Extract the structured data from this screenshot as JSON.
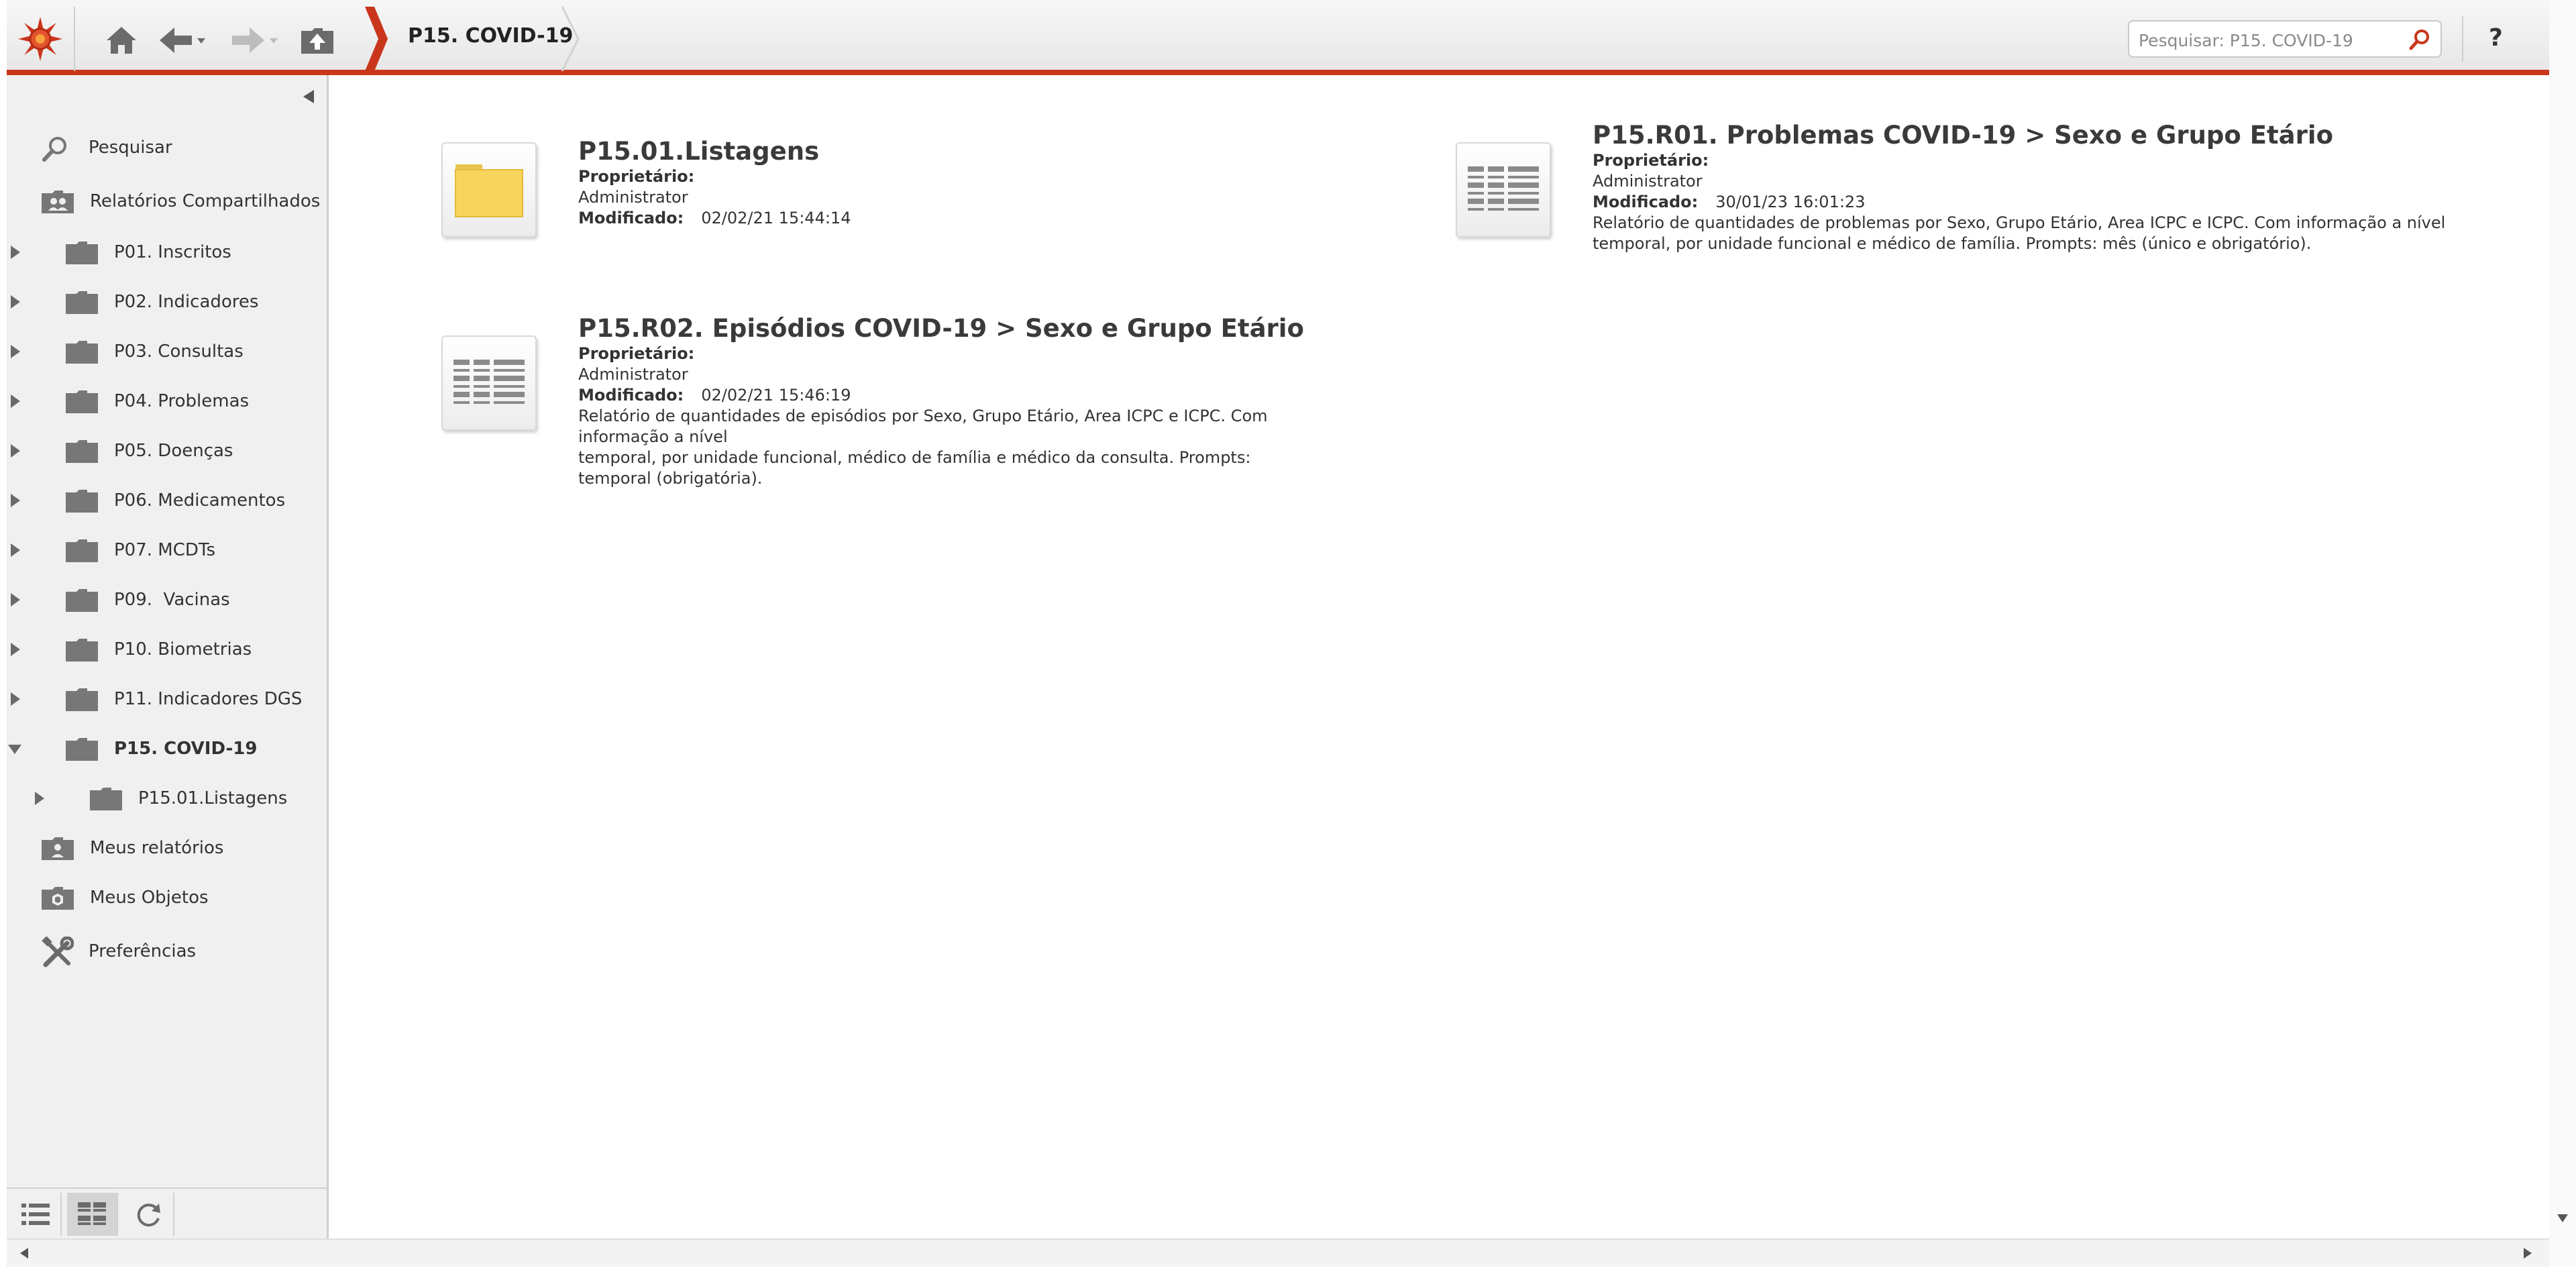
{
  "header": {
    "breadcrumb": "P15. COVID-19",
    "search_placeholder": "Pesquisar: P15. COVID-19",
    "help_label": "?"
  },
  "sidebar": {
    "search_label": "Pesquisar",
    "shared_label": "Relatórios Compartilhados",
    "folders": [
      {
        "label": "P01. Inscritos"
      },
      {
        "label": "P02. Indicadores"
      },
      {
        "label": "P03. Consultas"
      },
      {
        "label": "P04. Problemas"
      },
      {
        "label": "P05. Doenças"
      },
      {
        "label": "P06. Medicamentos"
      },
      {
        "label": "P07. MCDTs"
      },
      {
        "label": "P09.  Vacinas"
      },
      {
        "label": "P10. Biometrias"
      },
      {
        "label": "P11. Indicadores DGS"
      },
      {
        "label": "P15. COVID-19"
      }
    ],
    "subfolder_label": "P15.01.Listagens",
    "my_reports_label": "Meus relatórios",
    "my_objects_label": "Meus Objetos",
    "preferences_label": "Preferências"
  },
  "items": [
    {
      "title": "P15.01.Listagens",
      "owner_label": "Proprietário:",
      "owner": "Administrator",
      "modified_label": "Modificado:",
      "modified": "02/02/21 15:44:14"
    },
    {
      "title": "P15.R01. Problemas COVID-19 > Sexo e Grupo Etário",
      "owner_label": "Proprietário:",
      "owner": "Administrator",
      "modified_label": "Modificado:",
      "modified": "30/01/23 16:01:23",
      "description_line1": "Relatório de quantidades de problemas por Sexo, Grupo Etário, Area ICPC e ICPC. Com informação a nível",
      "description_line2": "temporal, por unidade funcional e médico de família. Prompts: mês (único e obrigatório)."
    },
    {
      "title": "P15.R02. Episódios COVID-19 > Sexo e Grupo Etário",
      "owner_label": "Proprietário:",
      "owner": "Administrator",
      "modified_label": "Modificado:",
      "modified": "02/02/21 15:46:19",
      "description_line1": "Relatório de quantidades de episódios por Sexo, Grupo Etário, Area ICPC e ICPC. Com informação a nível",
      "description_line2": "temporal, por unidade funcional, médico de família e médico da consulta. Prompts: temporal (obrigatória)."
    }
  ],
  "colors": {
    "accent": "#c9361b",
    "sidebar_bg": "#f0f0f0",
    "folder_yellow": "#f7d55c"
  }
}
